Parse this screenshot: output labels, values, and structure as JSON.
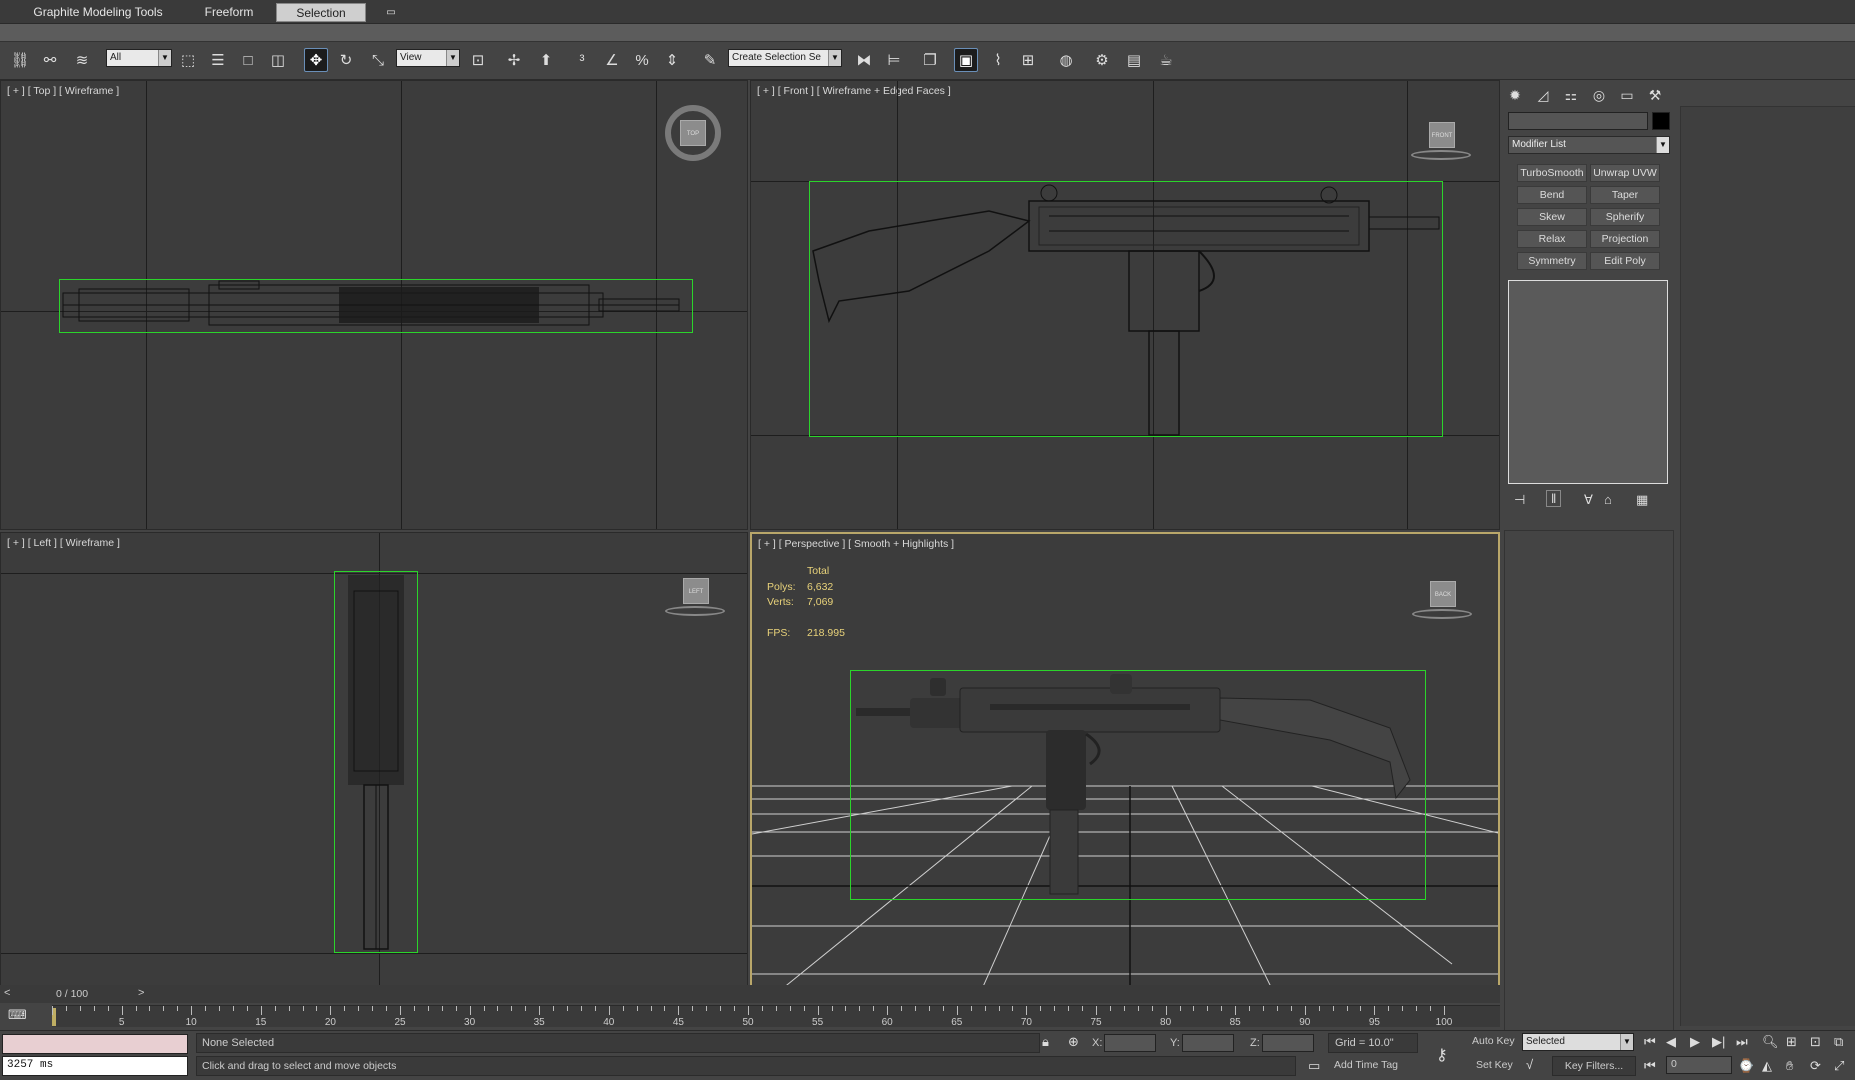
{
  "ribbon": {
    "tabs": [
      {
        "label": "Graphite Modeling Tools"
      },
      {
        "label": "Freeform"
      },
      {
        "label": "Selection",
        "active": true
      }
    ]
  },
  "toolbar": {
    "selection_filter": "All",
    "ref_coord": "View",
    "named_selection": "Create Selection Se"
  },
  "viewports": {
    "top": {
      "label": "[ + ] [ Top ] [ Wireframe ]",
      "cube": "TOP"
    },
    "front": {
      "label": "[ + ] [ Front ] [ Wireframe + Edged Faces ]",
      "cube": "FRONT"
    },
    "left": {
      "label": "[ + ] [ Left ] [ Wireframe ]",
      "cube": "LEFT"
    },
    "perspective": {
      "label": "[ + ] [ Perspective ] [ Smooth + Highlights ]",
      "cube": "BACK",
      "stats": {
        "header": "Total",
        "polys_label": "Polys:",
        "polys": "6,632",
        "verts_label": "Verts:",
        "verts": "7,069",
        "fps_label": "FPS:",
        "fps": "218.995"
      }
    }
  },
  "command_panel": {
    "modifier_list": "Modifier List",
    "buttons": [
      "TurboSmooth",
      "Unwrap UVW",
      "Bend",
      "Taper",
      "Skew",
      "Spherify",
      "Relax",
      "Projection",
      "Symmetry",
      "Edit Poly"
    ]
  },
  "timeline": {
    "slider": "0 / 100",
    "ticks": [
      "5",
      "10",
      "15",
      "20",
      "25",
      "30",
      "35",
      "40",
      "45",
      "50",
      "55",
      "60",
      "65",
      "70",
      "75",
      "80",
      "85",
      "90",
      "95",
      "100"
    ]
  },
  "status": {
    "listener": "3257 ms",
    "selection": "None Selected",
    "prompt": "Click and drag to select and move objects",
    "x": "X:",
    "y": "Y:",
    "z": "Z:",
    "grid": "Grid = 10.0\"",
    "add_time_tag": "Add Time Tag",
    "auto_key": "Auto Key",
    "set_key": "Set Key",
    "key_mode": "Selected",
    "key_filters": "Key Filters...",
    "frame": "0"
  },
  "colors": {
    "accent": "#2bd52b",
    "active_border": "#b9a76a",
    "stats_text": "#e8d27a"
  }
}
